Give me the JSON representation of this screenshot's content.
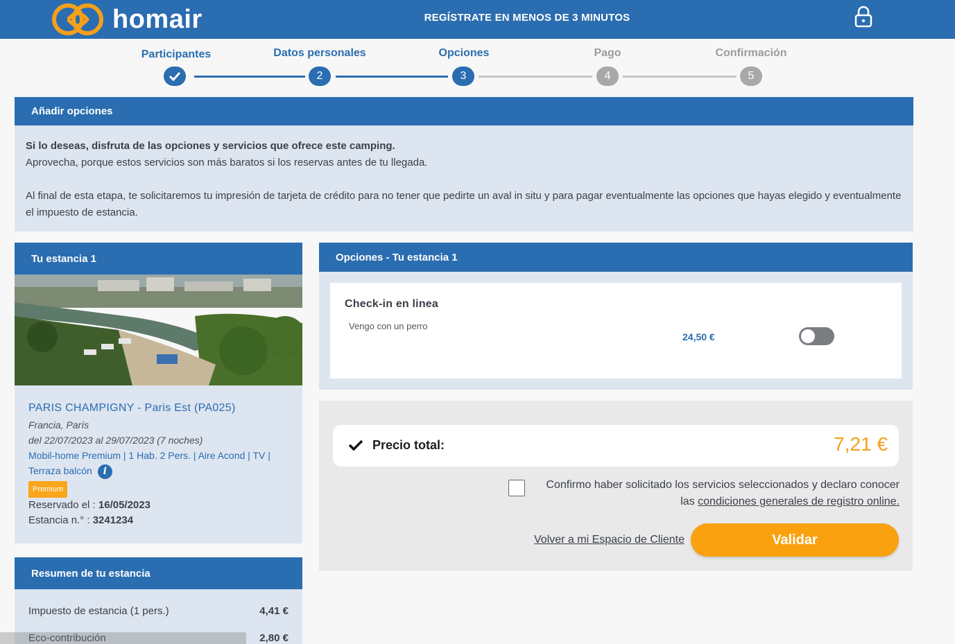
{
  "header": {
    "brand": "homair",
    "title": "REGÍSTRATE EN MENOS DE 3 MINUTOS",
    "logo_color": "#f5a01a",
    "bar_color": "#2a6db0"
  },
  "stepper": {
    "steps": [
      {
        "label": "Participantes",
        "marker": "✓",
        "state": "done"
      },
      {
        "label": "Datos personales",
        "marker": "2",
        "state": "done"
      },
      {
        "label": "Opciones",
        "marker": "3",
        "state": "current"
      },
      {
        "label": "Pago",
        "marker": "4",
        "state": "pending"
      },
      {
        "label": "Confirmación",
        "marker": "5",
        "state": "pending"
      }
    ]
  },
  "intro": {
    "heading": "Añadir opciones",
    "bold_line": "Si lo deseas, disfruta de las opciones y servicios que ofrece este camping.",
    "line2": "Aprovecha, porque estos servicios son más baratos si los reservas antes de tu llegada.",
    "paragraph": "Al final de esta etapa, te solicitaremos tu impresión de tarjeta de crédito para no tener que pedirte un aval in situ y para pagar eventualmente las opciones que hayas elegido y eventualmente el impuesto de estancia."
  },
  "stay": {
    "heading": "Tu estancia 1",
    "camp_name": "PARIS CHAMPIGNY - Paris Est (PA025)",
    "location": "Francia, París",
    "dates": "del 22/07/2023 al 29/07/2023 (7 noches)",
    "accommodation_line1": "Mobil-home Premium | 1 Hab. 2 Pers. | Aire Acond | TV |",
    "accommodation_line2": "Terraza balcón",
    "badge": "Premium",
    "booked_label": "Reservado el : ",
    "booked_date": "16/05/2023",
    "stay_no_label": "Estancia n.° : ",
    "stay_no": "3241234"
  },
  "summary": {
    "heading": "Resumen de tu estancia",
    "rows": [
      {
        "label": "Impuesto de estancia (1 pers.)",
        "value": "4,41 €"
      },
      {
        "label": "Eco-contribución",
        "value": "2,80 €"
      }
    ]
  },
  "options": {
    "heading": "Opciones - Tu estancia 1",
    "items": [
      {
        "title": "Check-in en linea",
        "subtitle": "Vengo con un perro",
        "price": "24,50 €",
        "enabled": false
      }
    ]
  },
  "total": {
    "label": "Precio total:",
    "value": "7,21 €",
    "confirm_text": "Confirmo haber solicitado los servicios seleccionados y declaro conocer las ",
    "confirm_link": "condiciones generales de registro online.",
    "confirm_checked": false,
    "back_link": "Volver a mi Espacio de Cliente",
    "validate_label": "Validar",
    "accent": "#f9a10f"
  }
}
